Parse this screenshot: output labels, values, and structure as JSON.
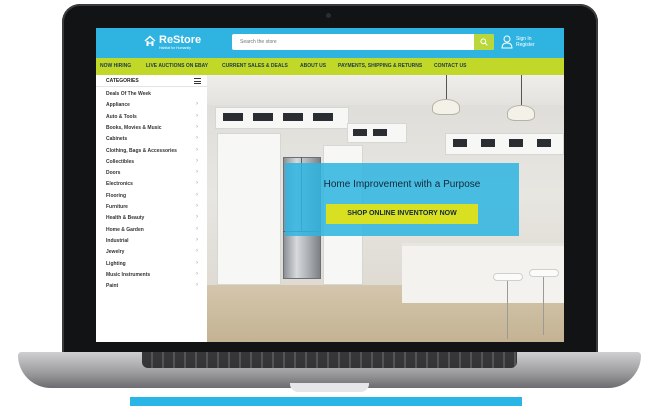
{
  "header": {
    "brand": "ReStore",
    "tagline": "Habitat for Humanity",
    "search_placeholder": "Search the store",
    "sign_in": "Sign In",
    "register": "Register"
  },
  "nav": [
    "NOW HIRING",
    "LIVE AUCTIONS ON EBAY",
    "CURRENT SALES & DEALS",
    "ABOUT US",
    "PAYMENTS, SHIPPING & RETURNS",
    "CONTACT US"
  ],
  "sidebar": {
    "title": "CATEGORIES",
    "items": [
      {
        "label": "Deals Of The Week",
        "has_arrow": false
      },
      {
        "label": "Appliance",
        "has_arrow": true
      },
      {
        "label": "Auto & Tools",
        "has_arrow": true
      },
      {
        "label": "Books, Movies & Music",
        "has_arrow": true
      },
      {
        "label": "Cabinets",
        "has_arrow": true
      },
      {
        "label": "Clothing, Bags & Accessories",
        "has_arrow": true
      },
      {
        "label": "Collectibles",
        "has_arrow": true
      },
      {
        "label": "Doors",
        "has_arrow": true
      },
      {
        "label": "Electronics",
        "has_arrow": true
      },
      {
        "label": "Flooring",
        "has_arrow": true
      },
      {
        "label": "Furniture",
        "has_arrow": true
      },
      {
        "label": "Health & Beauty",
        "has_arrow": true
      },
      {
        "label": "Home & Garden",
        "has_arrow": true
      },
      {
        "label": "Industrial",
        "has_arrow": true
      },
      {
        "label": "Jewelry",
        "has_arrow": true
      },
      {
        "label": "Lighting",
        "has_arrow": true
      },
      {
        "label": "Music Instruments",
        "has_arrow": true
      },
      {
        "label": "Paint",
        "has_arrow": true
      }
    ]
  },
  "hero": {
    "headline": "Home Improvement with a Purpose",
    "cta": "SHOP ONLINE INVENTORY NOW"
  },
  "icons": {
    "logo": "habitat-house-icon",
    "search": "search-icon",
    "account": "user-icon",
    "categories_menu": "list-icon",
    "category_arrow": "chevron-right-icon"
  },
  "colors": {
    "header_blue": "#2fb4e1",
    "nav_green": "#c2d829",
    "search_button": "#b9d63a",
    "cta_yellow": "#d9e021",
    "text_dark": "#10293a"
  }
}
